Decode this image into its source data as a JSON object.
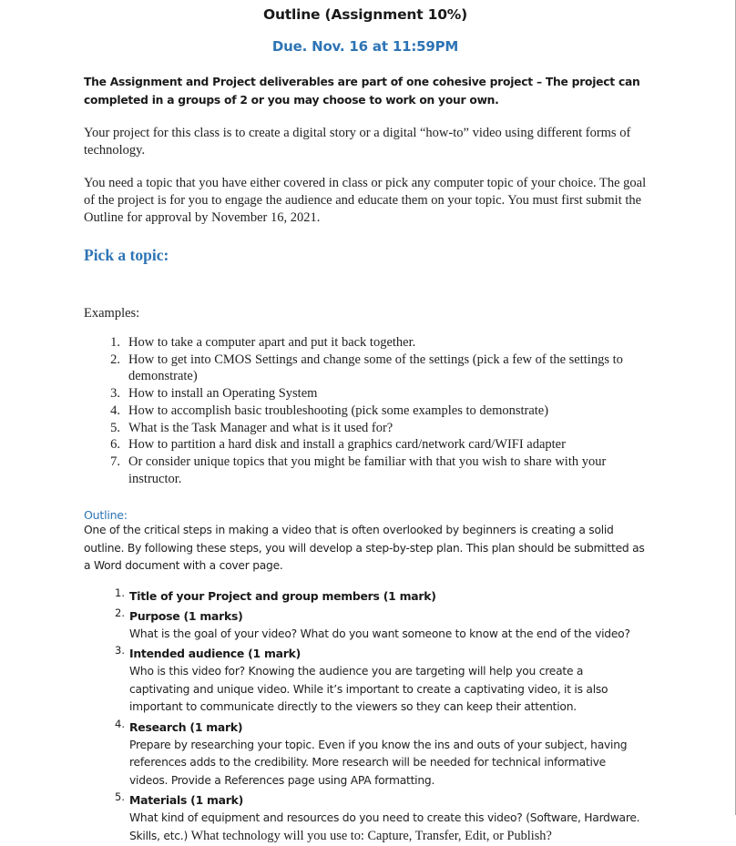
{
  "document": {
    "title": "Outline (Assignment 10%)",
    "due": "Due. Nov. 16 at 11:59PM",
    "accent_color": "#2e74b5",
    "text_color": "#212121",
    "intro_bold": "The Assignment and Project deliverables are part of one cohesive project – The project can completed in a groups of 2 or you may choose to work on your own.",
    "para_project": "Your project for this class is to create a digital story or a digital “how-to” video using different forms of technology.",
    "para_topic": "You need a topic that you have either covered in class or pick any computer topic of your choice.  The goal of the project is for you to engage the audience and educate them on your topic. You must first submit the Outline for approval by November 16, 2021.",
    "pick_topic_heading": "Pick a topic:",
    "examples_label": "Examples:",
    "examples": [
      {
        "n": "1.",
        "text": "How to take a computer apart and put it back together."
      },
      {
        "n": "2.",
        "text": "How to get into CMOS Settings and change some of the settings (pick a few of the settings to demonstrate)"
      },
      {
        "n": "3.",
        "text": "How to install an Operating System"
      },
      {
        "n": "4.",
        "text": "How to accomplish basic troubleshooting (pick some examples to demonstrate)"
      },
      {
        "n": "5.",
        "text": "What is the Task Manager and what is it used for?"
      },
      {
        "n": "6.",
        "text": "How to partition a hard disk and install a graphics card/network card/WIFI adapter"
      },
      {
        "n": "7.",
        "text": "Or consider unique topics that you might be familiar with that you wish to share with your instructor."
      }
    ],
    "outline_heading": "Outline:",
    "outline_intro": "One of the critical steps in making a video that is often overlooked by beginners is creating a solid outline. By following these steps, you will develop a step-by-step plan. This plan should be submitted as a Word document with a cover page.",
    "outline_items": [
      {
        "n": "1.",
        "title": "Title of your Project and group members (1 mark)",
        "desc": ""
      },
      {
        "n": "2.",
        "title": "Purpose (1 marks)",
        "desc": "What is the goal of your video? What do you want someone to know at the end of the video?"
      },
      {
        "n": "3.",
        "title": "Intended audience  (1 mark)",
        "desc": "Who is this video for? Knowing the audience you are targeting will help you create a captivating and unique video. While it’s important to create a captivating video, it is also important to communicate directly to the viewers so they can keep their attention."
      },
      {
        "n": "4.",
        "title": "Research (1 mark)",
        "desc": "Prepare by researching your topic. Even if you know the ins and outs of your subject, having references adds to the credibility. More research will be needed for technical informative videos.  Provide a References page using APA formatting."
      },
      {
        "n": "5.",
        "title": "Materials (1 mark)",
        "desc_part_1": "What kind of equipment and resources do you need to create this video? (Software, Hardware. Skills, etc.)  ",
        "desc_part_2": "What technology will you use to: Capture, Transfer, Edit, or Publish?"
      }
    ]
  }
}
